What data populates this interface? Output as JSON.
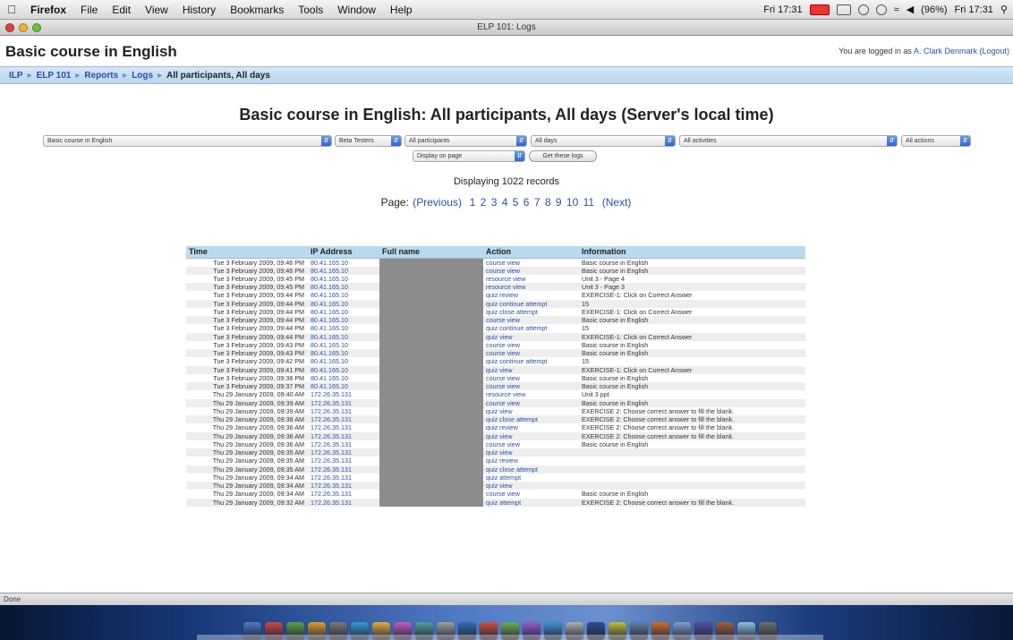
{
  "menubar": {
    "app": "Firefox",
    "items": [
      "File",
      "Edit",
      "View",
      "History",
      "Bookmarks",
      "Tools",
      "Window",
      "Help"
    ],
    "clock_left": "Fri 17:31",
    "clock_right": "Fri 17:31",
    "battery": "(96%)"
  },
  "window": {
    "title": "ELP 101: Logs"
  },
  "page": {
    "course_heading": "Basic course in English",
    "login_prefix": "You are logged in as",
    "login_user": "A. Clark Denmark",
    "logout": "(Logout)",
    "breadcrumb": [
      "ILP",
      "ELP 101",
      "Reports",
      "Logs",
      "All participants, All days"
    ],
    "report_title": "Basic course in English: All participants, All days (Server's local time)",
    "filters": {
      "course": "Basic course in English",
      "group": "Beta Testers",
      "participants": "All participants",
      "days": "All days",
      "activities": "All activities",
      "actions": "All actions",
      "display": "Display on page",
      "get_logs": "Get these logs"
    },
    "records_text": "Displaying 1022 records",
    "pager": {
      "label": "Page:",
      "previous": "(Previous)",
      "pages": [
        "1",
        "2",
        "3",
        "4",
        "5",
        "6",
        "7",
        "8",
        "9",
        "10",
        "11"
      ],
      "next": "(Next)"
    },
    "table": {
      "headers": [
        "Time",
        "IP Address",
        "Full name",
        "Action",
        "Information"
      ],
      "rows": [
        [
          "Tue 3 February 2009, 09:46 PM",
          "80.41.165.10",
          "",
          "course view",
          "Basic course in English"
        ],
        [
          "Tue 3 February 2009, 09:46 PM",
          "80.41.165.10",
          "",
          "course view",
          "Basic course in English"
        ],
        [
          "Tue 3 February 2009, 09:45 PM",
          "80.41.165.10",
          "",
          "resource view",
          "Unit 3 - Page 4"
        ],
        [
          "Tue 3 February 2009, 09:45 PM",
          "80.41.165.10",
          "",
          "resource view",
          "Unit 3 - Page 3"
        ],
        [
          "Tue 3 February 2009, 09:44 PM",
          "80.41.165.10",
          "",
          "quiz review",
          "EXERCISE-1: Click on Correct Answer"
        ],
        [
          "Tue 3 February 2009, 09:44 PM",
          "80.41.165.10",
          "",
          "quiz continue attempt",
          "15"
        ],
        [
          "Tue 3 February 2009, 09:44 PM",
          "80.41.165.10",
          "",
          "quiz close attempt",
          "EXERCISE-1: Click on Correct Answer"
        ],
        [
          "Tue 3 February 2009, 09:44 PM",
          "80.41.165.10",
          "",
          "course view",
          "Basic course in English"
        ],
        [
          "Tue 3 February 2009, 09:44 PM",
          "80.41.165.10",
          "",
          "quiz continue attempt",
          "15"
        ],
        [
          "Tue 3 February 2009, 09:44 PM",
          "80.41.165.10",
          "",
          "quiz view",
          "EXERCISE-1: Click on Correct Answer"
        ],
        [
          "Tue 3 February 2009, 09:43 PM",
          "80.41.165.10",
          "",
          "course view",
          "Basic course in English"
        ],
        [
          "Tue 3 February 2009, 09:43 PM",
          "80.41.165.10",
          "",
          "course view",
          "Basic course in English"
        ],
        [
          "Tue 3 February 2009, 09:42 PM",
          "80.41.165.10",
          "",
          "quiz continue attempt",
          "15"
        ],
        [
          "Tue 3 February 2009, 09:41 PM",
          "80.41.165.10",
          "",
          "quiz view",
          "EXERCISE-1: Click on Correct Answer"
        ],
        [
          "Tue 3 February 2009, 09:38 PM",
          "80.41.165.10",
          "",
          "course view",
          "Basic course in English"
        ],
        [
          "Tue 3 February 2009, 09:37 PM",
          "80.41.165.10",
          "",
          "course view",
          "Basic course in English"
        ],
        [
          "Thu 29 January 2009, 09:40 AM",
          "172.26.35.131",
          "",
          "resource view",
          "Unit 3 ppt"
        ],
        [
          "Thu 29 January 2009, 09:39 AM",
          "172.26.35.131",
          "",
          "course view",
          "Basic course in English"
        ],
        [
          "Thu 29 January 2009, 09:39 AM",
          "172.26.35.131",
          "",
          "quiz view",
          "EXERCISE 2: Choose correct answer to fill the blank."
        ],
        [
          "Thu 29 January 2009, 09:38 AM",
          "172.26.35.131",
          "",
          "quiz close attempt",
          "EXERCISE 2: Choose correct answer to fill the blank."
        ],
        [
          "Thu 29 January 2009, 09:36 AM",
          "172.26.35.131",
          "",
          "quiz review",
          "EXERCISE 2: Choose correct answer to fill the blank."
        ],
        [
          "Thu 29 January 2009, 09:36 AM",
          "172.26.35.131",
          "",
          "quiz view",
          "EXERCISE 2: Choose correct answer to fill the blank."
        ],
        [
          "Thu 29 January 2009, 09:36 AM",
          "172.26.35.131",
          "",
          "course view",
          "Basic course in English"
        ],
        [
          "Thu 29 January 2009, 09:35 AM",
          "172.26.35.131",
          "",
          "quiz view",
          ""
        ],
        [
          "Thu 29 January 2009, 09:35 AM",
          "172.26.35.131",
          "",
          "quiz review",
          ""
        ],
        [
          "Thu 29 January 2009, 09:35 AM",
          "172.26.35.131",
          "",
          "quiz close attempt",
          ""
        ],
        [
          "Thu 29 January 2009, 09:34 AM",
          "172.26.35.131",
          "",
          "quiz attempt",
          ""
        ],
        [
          "Thu 29 January 2009, 09:34 AM",
          "172.26.35.131",
          "",
          "quiz view",
          ""
        ],
        [
          "Thu 29 January 2009, 09:34 AM",
          "172.26.35.131",
          "",
          "course view",
          "Basic course in English"
        ],
        [
          "Thu 29 January 2009, 09:32 AM",
          "172.26.35.131",
          "",
          "quiz attempt",
          "EXERCISE 2: Choose correct answer to fill the blank."
        ]
      ]
    }
  },
  "statusbar": {
    "text": "Done"
  }
}
